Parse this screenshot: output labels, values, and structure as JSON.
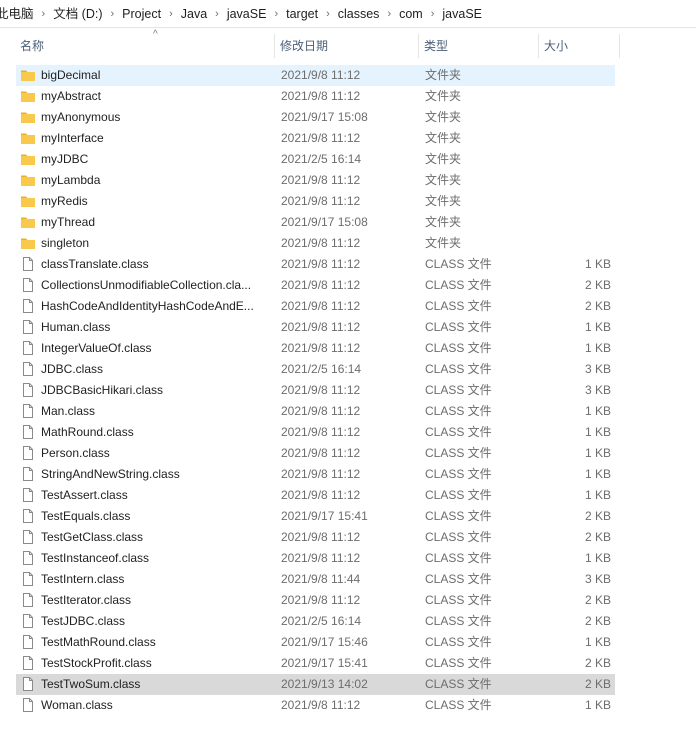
{
  "breadcrumb": [
    {
      "label": "此电脑",
      "sep": "›"
    },
    {
      "label": "文档 (D:)",
      "sep": "›"
    },
    {
      "label": "Project",
      "sep": "›"
    },
    {
      "label": "Java",
      "sep": "›"
    },
    {
      "label": "javaSE",
      "sep": "›"
    },
    {
      "label": "target",
      "sep": "›"
    },
    {
      "label": "classes",
      "sep": "›"
    },
    {
      "label": "com",
      "sep": "›"
    },
    {
      "label": "javaSE",
      "sep": ""
    }
  ],
  "columns": {
    "name": "名称",
    "date": "修改日期",
    "type": "类型",
    "size": "大小",
    "sort_indicator": "^"
  },
  "colors": {
    "folder": "#f8c94a",
    "folder_dark": "#e8b023",
    "hover_row": "#e5f3ff",
    "selected_row": "#d9d9d9",
    "header_text": "#4c607a"
  },
  "files": [
    {
      "name": "bigDecimal",
      "date": "2021/9/8 11:12",
      "type": "文件夹",
      "size": "",
      "icon": "folder-icon",
      "state": "hover"
    },
    {
      "name": "myAbstract",
      "date": "2021/9/8 11:12",
      "type": "文件夹",
      "size": "",
      "icon": "folder-icon",
      "state": ""
    },
    {
      "name": "myAnonymous",
      "date": "2021/9/17 15:08",
      "type": "文件夹",
      "size": "",
      "icon": "folder-icon",
      "state": ""
    },
    {
      "name": "myInterface",
      "date": "2021/9/8 11:12",
      "type": "文件夹",
      "size": "",
      "icon": "folder-icon",
      "state": ""
    },
    {
      "name": "myJDBC",
      "date": "2021/2/5 16:14",
      "type": "文件夹",
      "size": "",
      "icon": "folder-icon",
      "state": ""
    },
    {
      "name": "myLambda",
      "date": "2021/9/8 11:12",
      "type": "文件夹",
      "size": "",
      "icon": "folder-icon",
      "state": ""
    },
    {
      "name": "myRedis",
      "date": "2021/9/8 11:12",
      "type": "文件夹",
      "size": "",
      "icon": "folder-icon",
      "state": ""
    },
    {
      "name": "myThread",
      "date": "2021/9/17 15:08",
      "type": "文件夹",
      "size": "",
      "icon": "folder-icon",
      "state": ""
    },
    {
      "name": "singleton",
      "date": "2021/9/8 11:12",
      "type": "文件夹",
      "size": "",
      "icon": "folder-icon",
      "state": ""
    },
    {
      "name": "classTranslate.class",
      "date": "2021/9/8 11:12",
      "type": "CLASS 文件",
      "size": "1 KB",
      "icon": "file-icon",
      "state": ""
    },
    {
      "name": "CollectionsUnmodifiableCollection.cla...",
      "date": "2021/9/8 11:12",
      "type": "CLASS 文件",
      "size": "2 KB",
      "icon": "file-icon",
      "state": ""
    },
    {
      "name": "HashCodeAndIdentityHashCodeAndE...",
      "date": "2021/9/8 11:12",
      "type": "CLASS 文件",
      "size": "2 KB",
      "icon": "file-icon",
      "state": ""
    },
    {
      "name": "Human.class",
      "date": "2021/9/8 11:12",
      "type": "CLASS 文件",
      "size": "1 KB",
      "icon": "file-icon",
      "state": ""
    },
    {
      "name": "IntegerValueOf.class",
      "date": "2021/9/8 11:12",
      "type": "CLASS 文件",
      "size": "1 KB",
      "icon": "file-icon",
      "state": ""
    },
    {
      "name": "JDBC.class",
      "date": "2021/2/5 16:14",
      "type": "CLASS 文件",
      "size": "3 KB",
      "icon": "file-icon",
      "state": ""
    },
    {
      "name": "JDBCBasicHikari.class",
      "date": "2021/9/8 11:12",
      "type": "CLASS 文件",
      "size": "3 KB",
      "icon": "file-icon",
      "state": ""
    },
    {
      "name": "Man.class",
      "date": "2021/9/8 11:12",
      "type": "CLASS 文件",
      "size": "1 KB",
      "icon": "file-icon",
      "state": ""
    },
    {
      "name": "MathRound.class",
      "date": "2021/9/8 11:12",
      "type": "CLASS 文件",
      "size": "1 KB",
      "icon": "file-icon",
      "state": ""
    },
    {
      "name": "Person.class",
      "date": "2021/9/8 11:12",
      "type": "CLASS 文件",
      "size": "1 KB",
      "icon": "file-icon",
      "state": ""
    },
    {
      "name": "StringAndNewString.class",
      "date": "2021/9/8 11:12",
      "type": "CLASS 文件",
      "size": "1 KB",
      "icon": "file-icon",
      "state": ""
    },
    {
      "name": "TestAssert.class",
      "date": "2021/9/8 11:12",
      "type": "CLASS 文件",
      "size": "1 KB",
      "icon": "file-icon",
      "state": ""
    },
    {
      "name": "TestEquals.class",
      "date": "2021/9/17 15:41",
      "type": "CLASS 文件",
      "size": "2 KB",
      "icon": "file-icon",
      "state": ""
    },
    {
      "name": "TestGetClass.class",
      "date": "2021/9/8 11:12",
      "type": "CLASS 文件",
      "size": "2 KB",
      "icon": "file-icon",
      "state": ""
    },
    {
      "name": "TestInstanceof.class",
      "date": "2021/9/8 11:12",
      "type": "CLASS 文件",
      "size": "1 KB",
      "icon": "file-icon",
      "state": ""
    },
    {
      "name": "TestIntern.class",
      "date": "2021/9/8 11:44",
      "type": "CLASS 文件",
      "size": "3 KB",
      "icon": "file-icon",
      "state": ""
    },
    {
      "name": "TestIterator.class",
      "date": "2021/9/8 11:12",
      "type": "CLASS 文件",
      "size": "2 KB",
      "icon": "file-icon",
      "state": ""
    },
    {
      "name": "TestJDBC.class",
      "date": "2021/2/5 16:14",
      "type": "CLASS 文件",
      "size": "2 KB",
      "icon": "file-icon",
      "state": ""
    },
    {
      "name": "TestMathRound.class",
      "date": "2021/9/17 15:46",
      "type": "CLASS 文件",
      "size": "1 KB",
      "icon": "file-icon",
      "state": ""
    },
    {
      "name": "TestStockProfit.class",
      "date": "2021/9/17 15:41",
      "type": "CLASS 文件",
      "size": "2 KB",
      "icon": "file-icon",
      "state": ""
    },
    {
      "name": "TestTwoSum.class",
      "date": "2021/9/13 14:02",
      "type": "CLASS 文件",
      "size": "2 KB",
      "icon": "file-icon",
      "state": "selected"
    },
    {
      "name": "Woman.class",
      "date": "2021/9/8 11:12",
      "type": "CLASS 文件",
      "size": "1 KB",
      "icon": "file-icon",
      "state": ""
    }
  ]
}
